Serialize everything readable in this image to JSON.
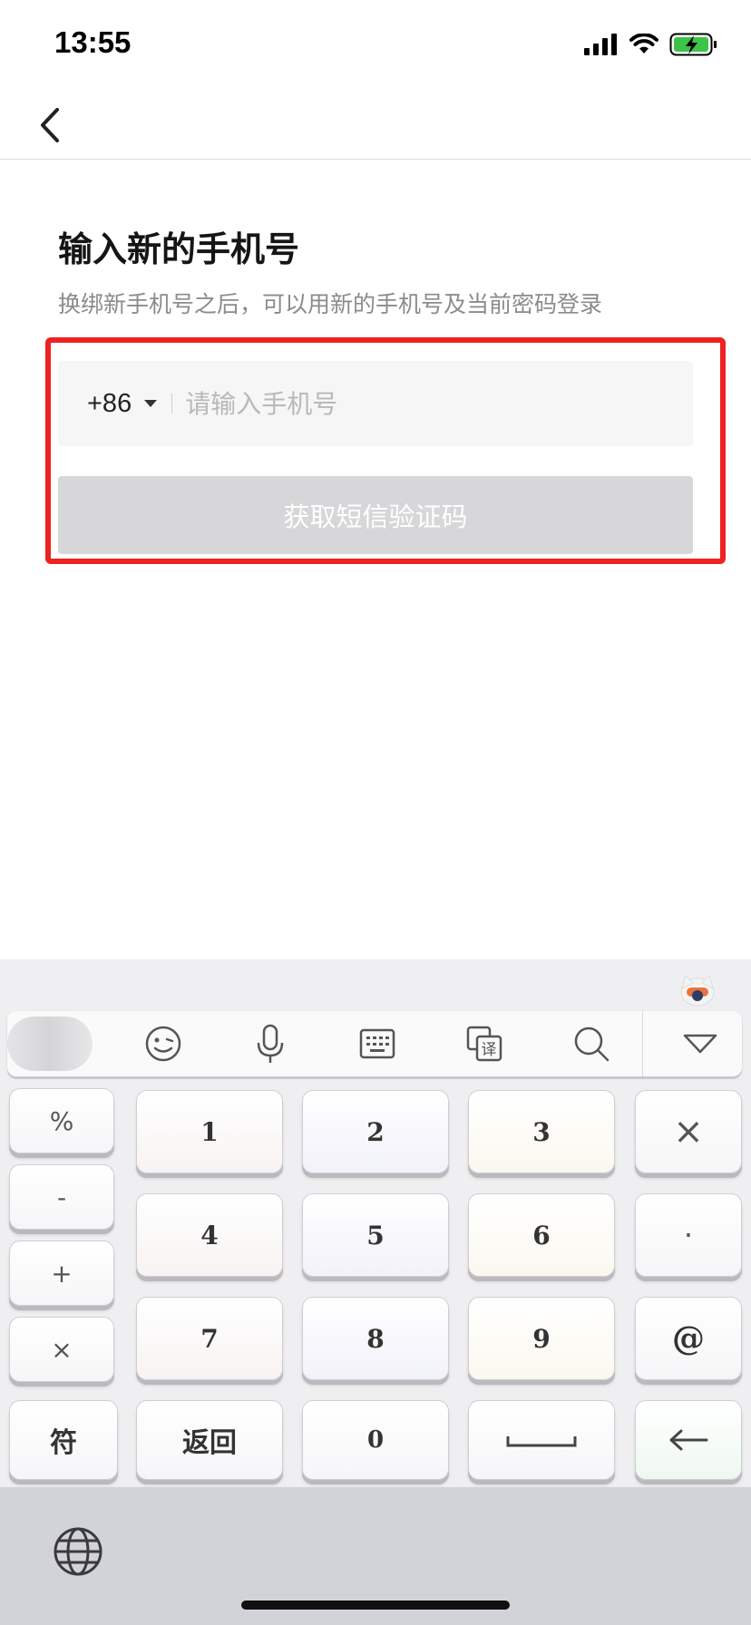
{
  "status_bar": {
    "time": "13:55"
  },
  "nav": {
    "back_icon": "chevron-left-icon"
  },
  "page": {
    "title": "输入新的手机号",
    "subtitle": "换绑新手机号之后，可以用新的手机号及当前密码登录"
  },
  "phone_form": {
    "country_code": "+86",
    "phone_placeholder": "请输入手机号",
    "phone_value": "",
    "sms_button_label": "获取短信验证码"
  },
  "highlight_color": "#ee2222",
  "keyboard": {
    "toolbar_icons": [
      "emoji-icon",
      "microphone-icon",
      "keyboard-icon",
      "translate-icon",
      "search-icon",
      "collapse-icon"
    ],
    "translate_glyph": "译",
    "left_column": [
      "%",
      "-",
      "+",
      "×"
    ],
    "rows": [
      [
        "1",
        "2",
        "3"
      ],
      [
        "4",
        "5",
        "6"
      ],
      [
        "7",
        "8",
        "9"
      ]
    ],
    "right_column": [
      "×",
      "·",
      "@"
    ],
    "bottom_row": {
      "symbols": "符",
      "back": "返回",
      "zero": "0",
      "space": "",
      "enter_icon": "arrow-left-icon"
    }
  }
}
